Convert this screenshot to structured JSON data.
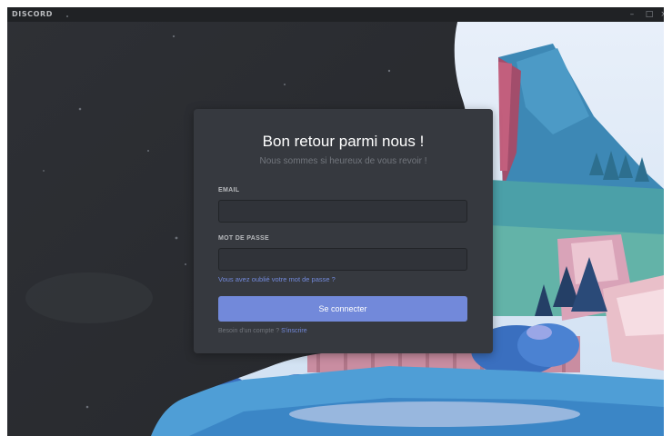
{
  "app": {
    "brand": "DISCORD",
    "window_controls": {
      "minimize": "–",
      "maximize": "□",
      "close": "×"
    }
  },
  "login": {
    "title": "Bon retour parmi nous !",
    "subtitle": "Nous sommes si heureux de vous revoir !",
    "email_label": "EMAIL",
    "email_value": "",
    "password_label": "MOT DE PASSE",
    "password_value": "",
    "forgot_password": "Vous avez oublié votre mot de passe ?",
    "submit_label": "Se connecter",
    "register_prompt": "Besoin d'un compte ?",
    "register_link": "S'inscrire"
  },
  "colors": {
    "accent": "#7289da",
    "card": "#36393f",
    "background": "#2f3136",
    "input": "#303339"
  },
  "icons": {
    "minimize": "minimize-icon",
    "maximize": "maximize-icon",
    "close": "close-icon"
  }
}
